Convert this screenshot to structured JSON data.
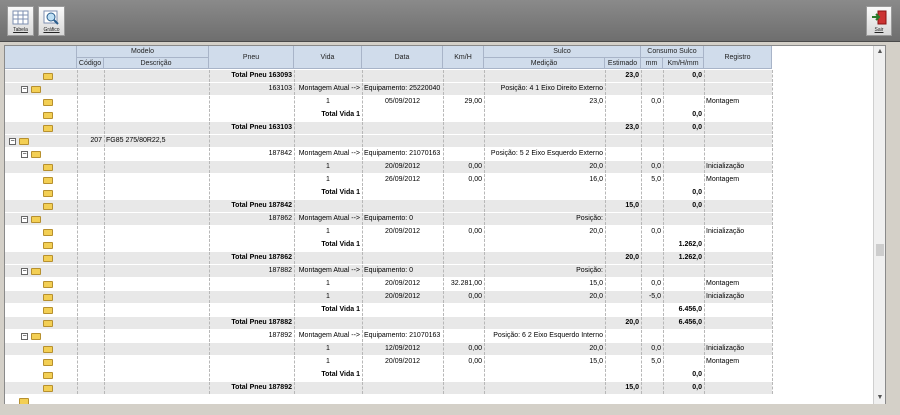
{
  "toolbar": {
    "buttons": [
      {
        "label": "Tabela",
        "icon": "table-icon"
      },
      {
        "label": "Gráfico",
        "icon": "chart-magnifier-icon"
      }
    ],
    "exit_label": "Sair"
  },
  "header": {
    "groups": {
      "modelo": "Modelo",
      "sulco": "Sulco",
      "consumo": "Consumo Sulco"
    },
    "columns": {
      "codigo": "Código",
      "descricao": "Descrição",
      "pneu": "Pneu",
      "vida": "Vida",
      "data": "Data",
      "kmh": "Km/H",
      "medicao": "Medição",
      "estimado": "Estimado",
      "mm": "mm",
      "kmhmm": "Km/H/mm",
      "registro": "Registro"
    }
  },
  "rows": [
    {
      "type": "total",
      "indent": 2,
      "pneu": "Total Pneu 163093",
      "estimado": "23,0",
      "kmhmm": "0,0"
    },
    {
      "type": "pneu",
      "indent": 1,
      "pneu": "163103",
      "vida": "Montagem Atual -->",
      "data": "Equipamento: 25220040",
      "medicao": "Posição: 4 1 Eixo Direito Externo"
    },
    {
      "type": "item",
      "indent": 2,
      "vida": "1",
      "data": "05/09/2012",
      "kmh": "29,00",
      "medicao": "23,0",
      "mm": "0,0",
      "registro": "Montagem"
    },
    {
      "type": "subtotal",
      "indent": 2,
      "vida": "Total Vida 1",
      "kmhmm": "0,0"
    },
    {
      "type": "total",
      "indent": 2,
      "pneu": "Total Pneu 163103",
      "estimado": "23,0",
      "kmhmm": "0,0"
    },
    {
      "type": "modelo",
      "indent": 0,
      "codigo": "207",
      "descricao": "FG85 275/80R22,5"
    },
    {
      "type": "pneu",
      "indent": 1,
      "pneu": "187842",
      "vida": "Montagem Atual -->",
      "data": "Equipamento: 21070163",
      "medicao": "Posição: 5 2 Eixo Esquerdo Externo"
    },
    {
      "type": "item",
      "indent": 2,
      "vida": "1",
      "data": "20/09/2012",
      "kmh": "0,00",
      "medicao": "20,0",
      "mm": "0,0",
      "registro": "Inicialização"
    },
    {
      "type": "item",
      "indent": 2,
      "vida": "1",
      "data": "26/09/2012",
      "kmh": "0,00",
      "medicao": "16,0",
      "mm": "5,0",
      "registro": "Montagem"
    },
    {
      "type": "subtotal",
      "indent": 2,
      "vida": "Total Vida 1",
      "kmhmm": "0,0"
    },
    {
      "type": "total",
      "indent": 2,
      "pneu": "Total Pneu 187842",
      "estimado": "15,0",
      "kmhmm": "0,0"
    },
    {
      "type": "pneu",
      "indent": 1,
      "pneu": "187862",
      "vida": "Montagem Atual -->",
      "data": "Equipamento: 0",
      "medicao": "Posição:"
    },
    {
      "type": "item",
      "indent": 2,
      "vida": "1",
      "data": "20/09/2012",
      "kmh": "0,00",
      "medicao": "20,0",
      "mm": "0,0",
      "registro": "Inicialização"
    },
    {
      "type": "subtotal",
      "indent": 2,
      "vida": "Total Vida 1",
      "kmhmm": "1.262,0"
    },
    {
      "type": "total",
      "indent": 2,
      "pneu": "Total Pneu 187862",
      "estimado": "20,0",
      "kmhmm": "1.262,0"
    },
    {
      "type": "pneu",
      "indent": 1,
      "pneu": "187882",
      "vida": "Montagem Atual -->",
      "data": "Equipamento: 0",
      "medicao": "Posição:"
    },
    {
      "type": "item",
      "indent": 2,
      "vida": "1",
      "data": "20/09/2012",
      "kmh": "32.281,00",
      "medicao": "15,0",
      "mm": "0,0",
      "registro": "Montagem"
    },
    {
      "type": "item",
      "indent": 2,
      "vida": "1",
      "data": "20/09/2012",
      "kmh": "0,00",
      "medicao": "20,0",
      "mm": "-5,0",
      "registro": "Inicialização"
    },
    {
      "type": "subtotal",
      "indent": 2,
      "vida": "Total Vida 1",
      "kmhmm": "6.456,0"
    },
    {
      "type": "total",
      "indent": 2,
      "pneu": "Total Pneu 187882",
      "estimado": "20,0",
      "kmhmm": "6.456,0"
    },
    {
      "type": "pneu",
      "indent": 1,
      "pneu": "187892",
      "vida": "Montagem Atual -->",
      "data": "Equipamento: 21070163",
      "medicao": "Posição: 6 2 Eixo Esquerdo Interno"
    },
    {
      "type": "item",
      "indent": 2,
      "vida": "1",
      "data": "12/09/2012",
      "kmh": "0,00",
      "medicao": "20,0",
      "mm": "0,0",
      "registro": "Inicialização"
    },
    {
      "type": "item",
      "indent": 2,
      "vida": "1",
      "data": "20/09/2012",
      "kmh": "0,00",
      "medicao": "15,0",
      "mm": "5,0",
      "registro": "Montagem"
    },
    {
      "type": "subtotal",
      "indent": 2,
      "vida": "Total Vida 1",
      "kmhmm": "0,0"
    },
    {
      "type": "total",
      "indent": 2,
      "pneu": "Total Pneu 187892",
      "estimado": "15,0",
      "kmhmm": "0,0"
    }
  ]
}
